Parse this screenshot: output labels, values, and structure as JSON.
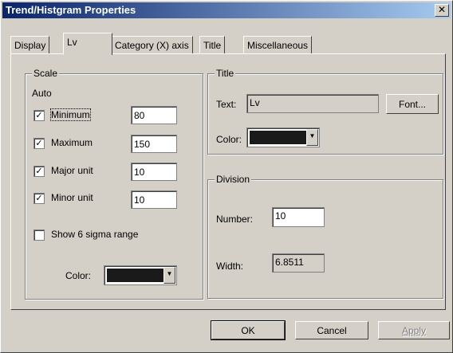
{
  "window": {
    "title": "Trend/Histgram Properties",
    "close_glyph": "✕"
  },
  "tabs": [
    {
      "label": "Display"
    },
    {
      "label": "Lv",
      "active": true
    },
    {
      "label": "Category (X) axis"
    },
    {
      "label": "Title"
    },
    {
      "label": "Miscellaneous"
    }
  ],
  "scale": {
    "legend": "Scale",
    "auto_label": "Auto",
    "minimum": {
      "label": "Minimum",
      "checked": true,
      "value": "80"
    },
    "maximum": {
      "label": "Maximum",
      "checked": true,
      "value": "150"
    },
    "major_unit": {
      "label": "Major unit",
      "checked": true,
      "value": "10"
    },
    "minor_unit": {
      "label": "Minor unit",
      "checked": true,
      "value": "10"
    },
    "sigma": {
      "label": "Show 6 sigma range",
      "checked": false
    },
    "color_label": "Color:",
    "color_value": "#1a1a1a"
  },
  "title_group": {
    "legend": "Title",
    "text_label": "Text:",
    "text_value": "Lv",
    "font_button": "Font...",
    "color_label": "Color:",
    "color_value": "#1a1a1a"
  },
  "division": {
    "legend": "Division",
    "number_label": "Number:",
    "number_value": "10",
    "width_label": "Width:",
    "width_value": "6.8511"
  },
  "buttons": {
    "ok": "OK",
    "cancel": "Cancel",
    "apply": "Apply"
  },
  "check_glyph": "✓"
}
